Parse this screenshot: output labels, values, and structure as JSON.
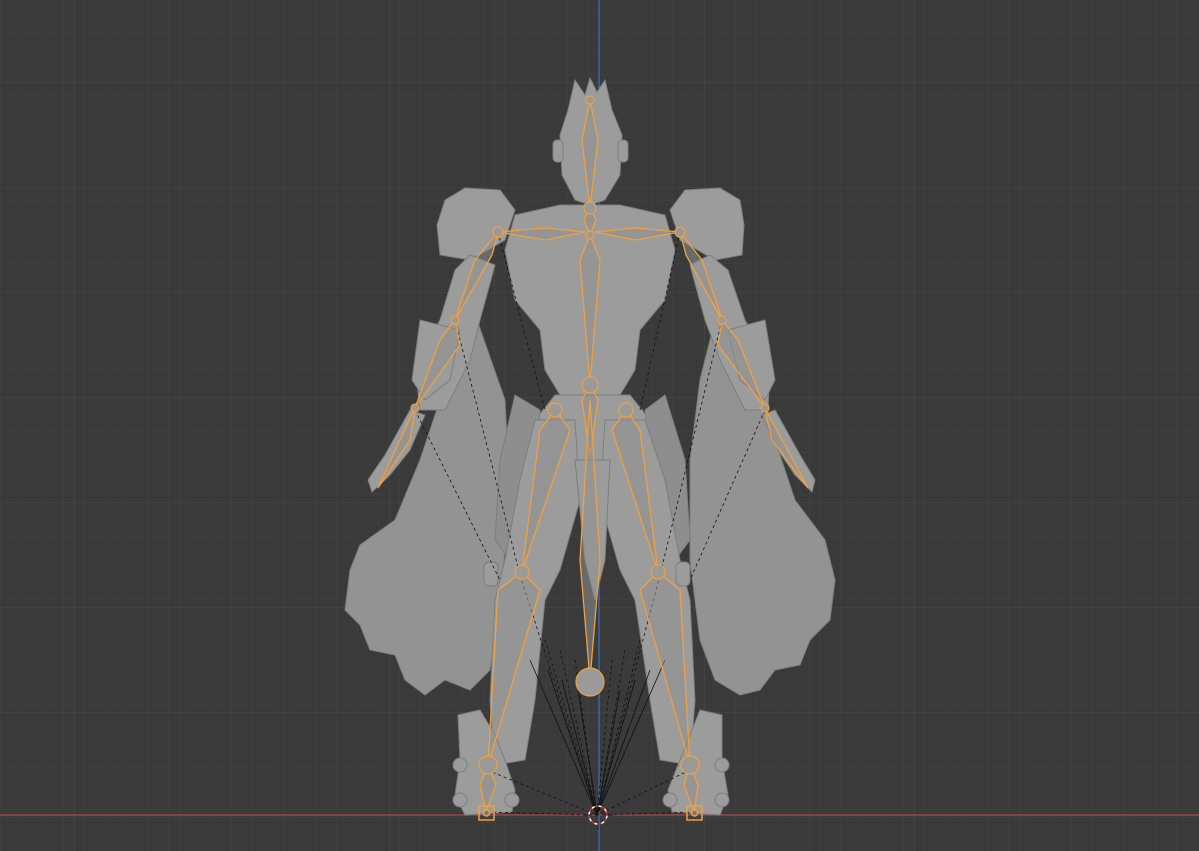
{
  "viewport": {
    "mode": "front-orthographic",
    "background_color": "#3a3a3a",
    "grid_minor_color": "#444444",
    "grid_major_color": "#4c4c4c",
    "axis_x_color": "#c0474b",
    "axis_z_color": "#3b6fc4",
    "model_color": "#9a9a9a",
    "armature_selected_color": "#f0a040",
    "relationship_line_color": "#000000",
    "cursor_color": "#c83232"
  },
  "scene": {
    "objects": [
      {
        "name": "character-mesh",
        "kind": "mesh"
      },
      {
        "name": "armature",
        "kind": "armature",
        "selected": true
      }
    ]
  }
}
